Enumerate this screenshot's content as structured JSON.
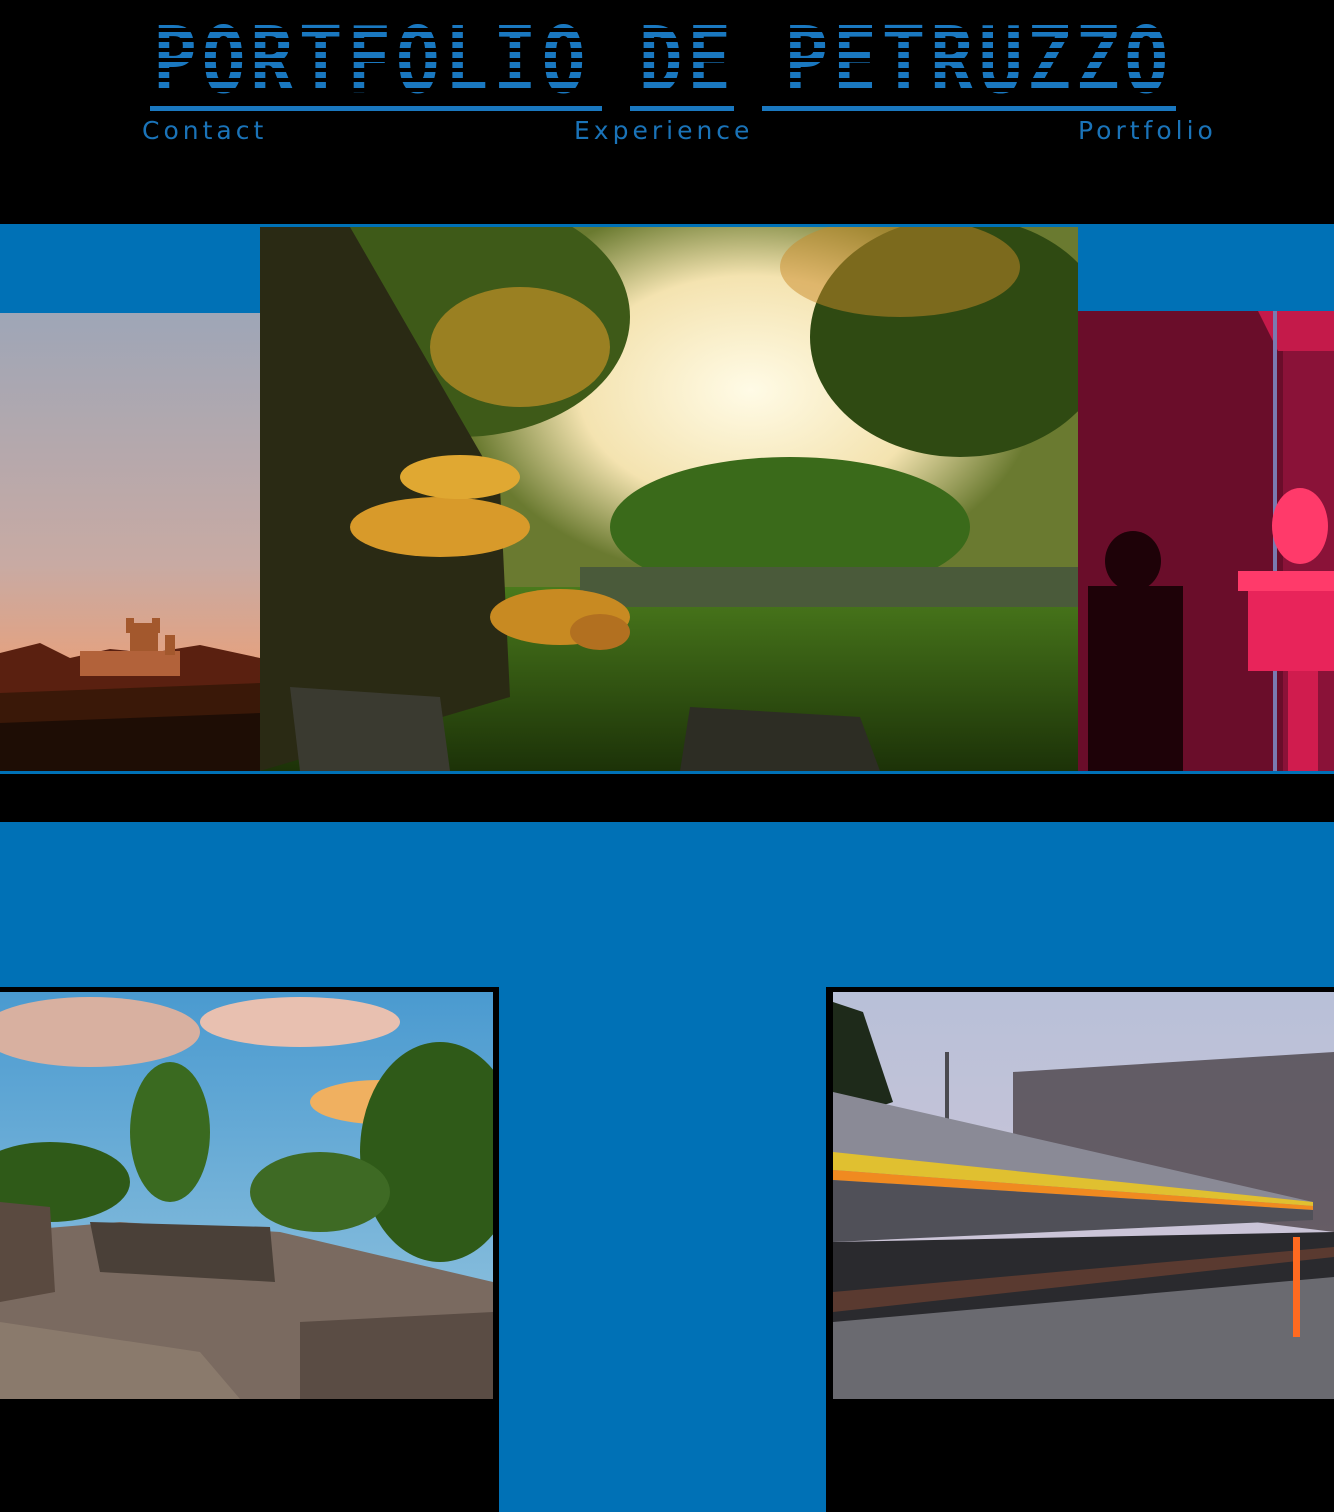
{
  "site": {
    "title": "PORTFOLIO DE PETRUZZO"
  },
  "nav": {
    "contact": "Contact",
    "experience": "Experience",
    "portfolio": "Portfolio"
  },
  "colors": {
    "accent": "#0071b6",
    "background": "#000000",
    "nav_text": "#1a73b8"
  },
  "gallery": {
    "carousel": [
      {
        "subject": "castle-at-sunset"
      },
      {
        "subject": "fungus-on-tree"
      },
      {
        "subject": "red-lit-skeleton"
      }
    ],
    "grid": [
      {
        "subject": "stone-quarry-landscape"
      },
      {
        "subject": "speeding-train"
      }
    ]
  }
}
